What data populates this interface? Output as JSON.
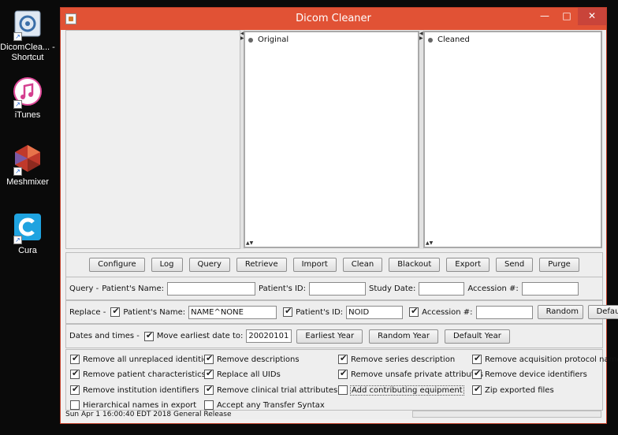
{
  "desktop": {
    "icons": [
      {
        "label": "DicomClea... - Shortcut",
        "icon": "dicom-cleaner-icon"
      },
      {
        "label": "iTunes",
        "icon": "itunes-icon"
      },
      {
        "label": "Meshmixer",
        "icon": "meshmixer-icon"
      },
      {
        "label": "Cura",
        "icon": "cura-icon"
      }
    ]
  },
  "window": {
    "title": "Dicom Cleaner",
    "controls": {
      "minimize": "—",
      "maximize": "□",
      "close": "✕"
    },
    "accent": "#e15235"
  },
  "panes": {
    "original": "Original",
    "cleaned": "Cleaned"
  },
  "buttons": {
    "configure": "Configure",
    "log": "Log",
    "query": "Query",
    "retrieve": "Retrieve",
    "import": "Import",
    "clean": "Clean",
    "blackout": "Blackout",
    "export": "Export",
    "send": "Send",
    "purge": "Purge"
  },
  "query": {
    "label": "Query -",
    "patient_name_label": "Patient's Name:",
    "patient_name_value": "",
    "patient_id_label": "Patient's ID:",
    "patient_id_value": "",
    "study_date_label": "Study Date:",
    "study_date_value": "",
    "accession_label": "Accession #:",
    "accession_value": ""
  },
  "replace": {
    "label": "Replace -",
    "patient_name_label": "Patient's Name:",
    "patient_name_checked": true,
    "patient_name_value": "NAME^NONE",
    "patient_id_label": "Patient's ID:",
    "patient_id_checked": true,
    "patient_id_value": "NOID",
    "accession_label": "Accession #:",
    "accession_checked": true,
    "accession_value": "",
    "random_button": "Random",
    "default_button": "Default"
  },
  "dates": {
    "label": "Dates and times -",
    "move_label": "Move earliest date to:",
    "move_checked": true,
    "date_value": "20020101",
    "earliest_year_button": "Earliest Year",
    "random_year_button": "Random Year",
    "default_year_button": "Default Year"
  },
  "options": [
    {
      "label": "Remove all unreplaced identities",
      "checked": true
    },
    {
      "label": "Remove descriptions",
      "checked": true
    },
    {
      "label": "Remove series description",
      "checked": true
    },
    {
      "label": "Remove acquisition protocol name",
      "checked": true
    },
    {
      "label": "Remove patient characteristics",
      "checked": true
    },
    {
      "label": "Replace all UIDs",
      "checked": true
    },
    {
      "label": "Remove unsafe private attributes",
      "checked": true
    },
    {
      "label": "Remove device identifiers",
      "checked": true
    },
    {
      "label": "Remove institution identifiers",
      "checked": true
    },
    {
      "label": "Remove clinical trial attributes",
      "checked": true
    },
    {
      "label": "Add contributing equipment",
      "checked": false
    },
    {
      "label": "Zip exported files",
      "checked": true
    },
    {
      "label": "Hierarchical names in export",
      "checked": false
    },
    {
      "label": "Accept any Transfer Syntax",
      "checked": false
    }
  ],
  "status": "Sun Apr  1 16:00:40 EDT 2018 General Release"
}
